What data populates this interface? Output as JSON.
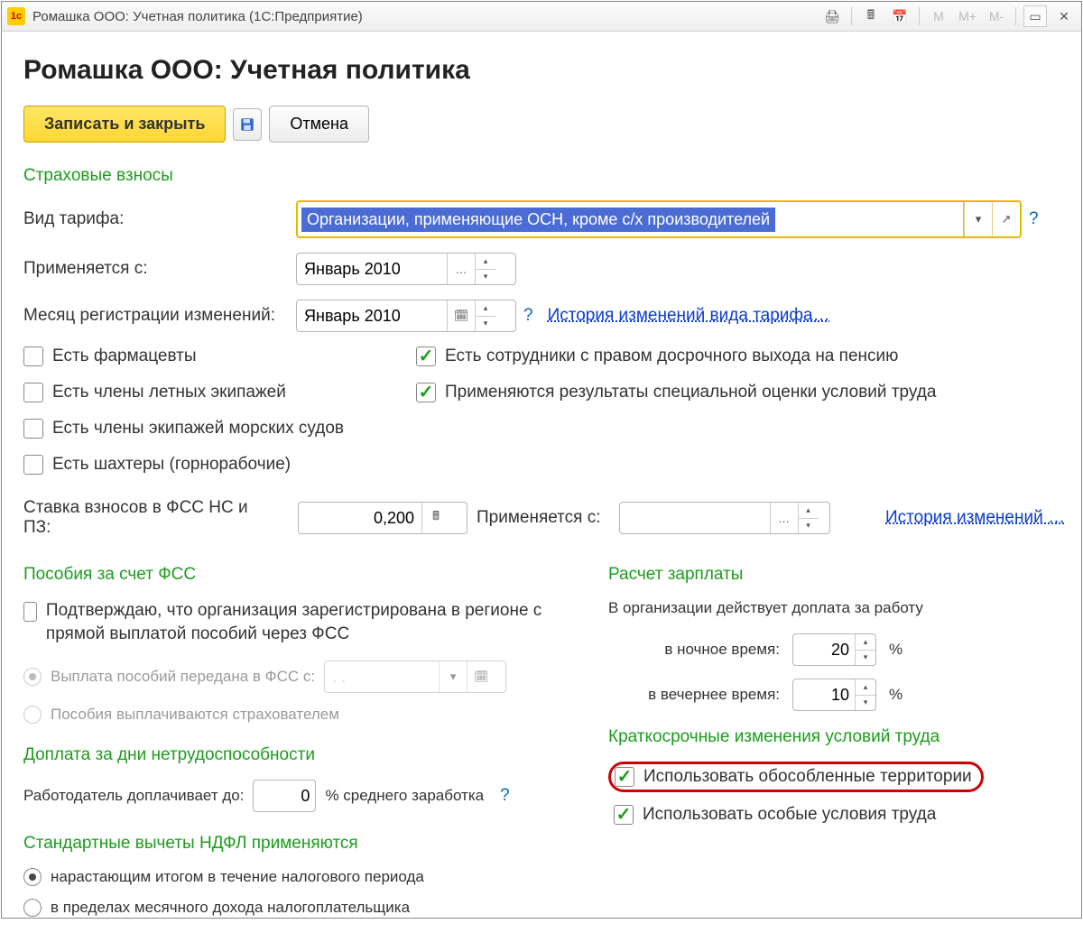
{
  "titlebar": {
    "title": "Ромашка ООО: Учетная политика  (1С:Предприятие)"
  },
  "page_title": "Ромашка ООО: Учетная политика",
  "toolbar": {
    "save_close": "Записать и закрыть",
    "cancel": "Отмена"
  },
  "sections": {
    "insurance": "Страховые взносы",
    "fss_benefits": "Пособия за счет ФСС",
    "sick_extra": "Доплата за дни нетрудоспособности",
    "ndfl": "Стандартные вычеты НДФЛ применяются",
    "salary": "Расчет зарплаты",
    "short_term": "Краткосрочные изменения условий труда"
  },
  "labels": {
    "tariff_type": "Вид тарифа:",
    "applies_from": "Применяется с:",
    "month_reg": "Месяц регистрации изменений:",
    "fss_rate": "Ставка взносов в ФСС НС и ПЗ:",
    "applies_from2": "Применяется с:",
    "employer_extra": "Работодатель доплачивает до:",
    "avg_earnings": "% среднего заработка",
    "salary_intro": "В организации действует доплата за работу",
    "night": "в ночное время:",
    "evening": "в вечернее время:",
    "percent": "%"
  },
  "values": {
    "tariff_type": "Организации, применяющие ОСН, кроме с/х производителей",
    "applies_from": "Январь 2010",
    "month_reg": "Январь 2010",
    "fss_rate": "0,200",
    "date2": "",
    "employer_extra": "0",
    "night_pct": "20",
    "evening_pct": "10",
    "fss_transfer_date": ". ."
  },
  "links": {
    "tariff_history": "История изменений вида тарифа…",
    "history2": "История изменений …"
  },
  "checkboxes": {
    "pharmacists": "Есть фармацевты",
    "flight_crew": "Есть члены летных экипажей",
    "sea_crew": "Есть члены экипажей морских судов",
    "miners": "Есть шахтеры (горнорабочие)",
    "early_pension": "Есть сотрудники с правом досрочного выхода на пенсию",
    "spec_eval": "Применяются результаты специальной оценки условий труда",
    "fss_confirm": "Подтверждаю, что организация зарегистрирована в регионе с прямой выплатой пособий через ФСС",
    "separate_territories": "Использовать обособленные территории",
    "special_conditions": "Использовать особые условия труда"
  },
  "radios": {
    "fss_to_fss": "Выплата пособий передана в ФСС с:",
    "fss_by_insurer": "Пособия выплачиваются страхователем",
    "ndfl_cumulative": "нарастающим итогом в течение налогового периода",
    "ndfl_monthly": "в пределах месячного дохода налогоплательщика"
  }
}
